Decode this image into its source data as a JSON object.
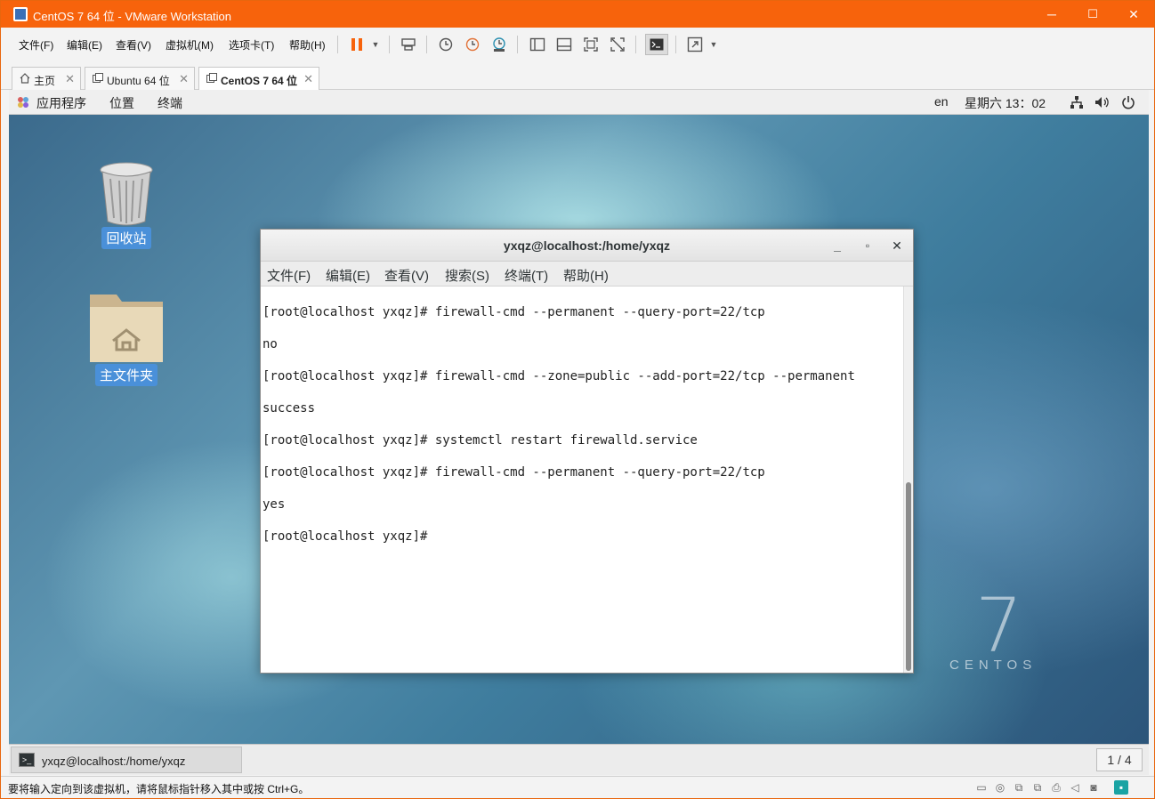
{
  "window": {
    "title": "CentOS 7 64 位 - VMware Workstation",
    "minimize": "─",
    "maximize": "☐",
    "close": "✕"
  },
  "menubar": {
    "items": [
      "文件(F)",
      "编辑(E)",
      "查看(V)",
      "虚拟机(M)",
      "选项卡(T)",
      "帮助(H)"
    ]
  },
  "toolbar": {
    "icons": [
      "pause-icon",
      "dropdown-arrow-icon",
      "send-ctrl-alt-del-icon",
      "snapshot-icon",
      "revert-snapshot-icon",
      "snapshot-manager-icon",
      "show-library-icon",
      "thumbnail-bar-icon",
      "fullscreen-icon",
      "unity-icon",
      "console-view-icon",
      "stretch-icon",
      "dropdown-arrow-icon"
    ]
  },
  "tabs": [
    {
      "label": "主页",
      "icon": "home-icon",
      "active": false
    },
    {
      "label": "Ubuntu 64 位",
      "icon": "vm-icon",
      "active": false
    },
    {
      "label": "CentOS 7 64 位",
      "icon": "vm-icon",
      "active": true
    }
  ],
  "gnome_top": {
    "applications": "应用程序",
    "places": "位置",
    "terminal": "终端",
    "language": "en",
    "clock": "星期六 13：02"
  },
  "desktop": {
    "icons": [
      {
        "label": "回收站",
        "icon": "trash-icon"
      },
      {
        "label": "主文件夹",
        "icon": "home-folder-icon"
      }
    ],
    "logo_number": "7",
    "logo_text": "CENTOS"
  },
  "terminal": {
    "title": "yxqz@localhost:/home/yxqz",
    "menu": [
      "文件(F)",
      "编辑(E)",
      "查看(V)",
      "搜索(S)",
      "终端(T)",
      "帮助(H)"
    ],
    "lines": [
      "[root@localhost yxqz]# firewall-cmd --permanent --query-port=22/tcp",
      "no",
      "[root@localhost yxqz]# firewall-cmd --zone=public --add-port=22/tcp --permanent",
      "success",
      "[root@localhost yxqz]# systemctl restart firewalld.service",
      "[root@localhost yxqz]# firewall-cmd --permanent --query-port=22/tcp",
      "yes",
      "[root@localhost yxqz]# "
    ]
  },
  "taskbar": {
    "task_label": "yxqz@localhost:/home/yxqz",
    "workspace": "1 / 4"
  },
  "statusbar": {
    "message": "要将输入定向到该虚拟机，请将鼠标指针移入其中或按 Ctrl+G。"
  },
  "colors": {
    "vmware_titlebar": "#f7630c",
    "selection": "#4a90d9"
  }
}
